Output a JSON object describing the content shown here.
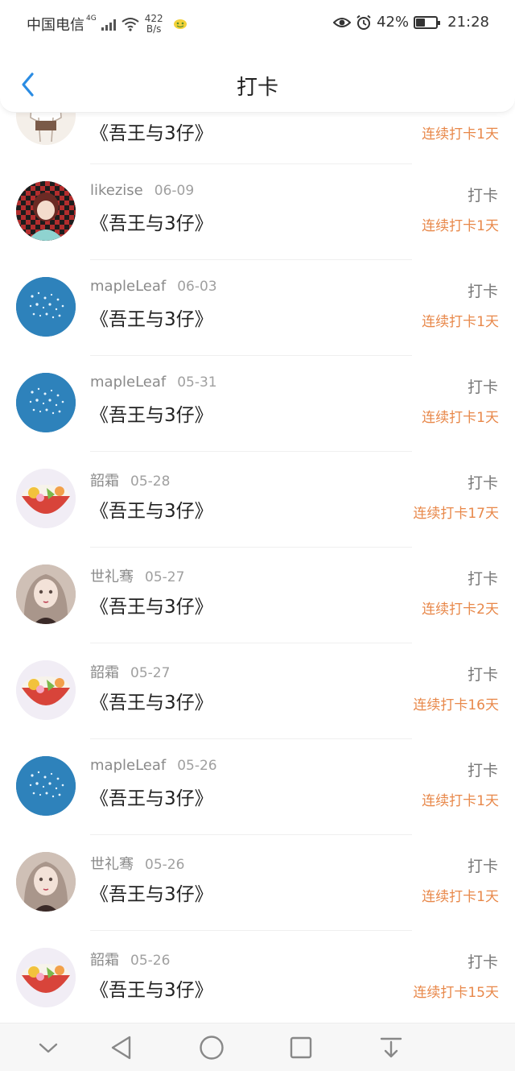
{
  "status_bar": {
    "carrier": "中国电信",
    "network": "4G",
    "speed_value": "422",
    "speed_unit": "B/s",
    "battery": "42%",
    "time": "21:28"
  },
  "header": {
    "title": "打卡"
  },
  "partial_row": {
    "book": "《吾王与3仔》",
    "streak": "连续打卡1天"
  },
  "records": [
    {
      "user": "likezise",
      "date": "06-09",
      "book": "《吾王与3仔》",
      "action": "打卡",
      "streak": "连续打卡1天"
    },
    {
      "user": "mapleLeaf",
      "date": "06-03",
      "book": "《吾王与3仔》",
      "action": "打卡",
      "streak": "连续打卡1天"
    },
    {
      "user": "mapleLeaf",
      "date": "05-31",
      "book": "《吾王与3仔》",
      "action": "打卡",
      "streak": "连续打卡1天"
    },
    {
      "user": "韶霜",
      "date": "05-28",
      "book": "《吾王与3仔》",
      "action": "打卡",
      "streak": "连续打卡17天"
    },
    {
      "user": "世礼骞",
      "date": "05-27",
      "book": "《吾王与3仔》",
      "action": "打卡",
      "streak": "连续打卡2天"
    },
    {
      "user": "韶霜",
      "date": "05-27",
      "book": "《吾王与3仔》",
      "action": "打卡",
      "streak": "连续打卡16天"
    },
    {
      "user": "mapleLeaf",
      "date": "05-26",
      "book": "《吾王与3仔》",
      "action": "打卡",
      "streak": "连续打卡1天"
    },
    {
      "user": "世礼骞",
      "date": "05-26",
      "book": "《吾王与3仔》",
      "action": "打卡",
      "streak": "连续打卡1天"
    },
    {
      "user": "韶霜",
      "date": "05-26",
      "book": "《吾王与3仔》",
      "action": "打卡",
      "streak": "连续打卡15天"
    }
  ],
  "icons": {
    "back": "chevron-left-icon",
    "nav_hide": "chevron-down-icon",
    "nav_back": "triangle-back-icon",
    "nav_home": "circle-home-icon",
    "nav_recents": "square-recents-icon",
    "nav_pulldown": "pull-down-icon"
  },
  "colors": {
    "accent": "#2b8ce3",
    "streak": "#e8884a"
  }
}
